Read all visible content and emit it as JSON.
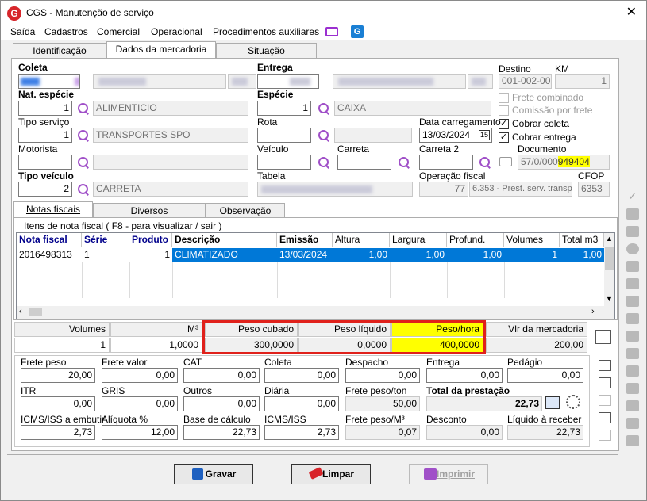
{
  "window": {
    "title": "CGS - Manutenção de serviço",
    "close": "✕"
  },
  "menu": [
    "Saída",
    "Cadastros",
    "Comercial",
    "Operacional",
    "Procedimentos auxiliares"
  ],
  "tabs": [
    "Identificação",
    "Dados da mercadoria",
    "Situação"
  ],
  "form": {
    "coleta_label": "Coleta",
    "entrega_label": "Entrega",
    "destino_label": "Destino",
    "destino_value": "001-002-002",
    "km_label": "KM",
    "km_value": "1",
    "nat_especie_label": "Nat. espécie",
    "nat_especie_code": "1",
    "nat_especie_desc": "ALIMENTICIO",
    "especie_label": "Espécie",
    "especie_code": "1",
    "especie_desc": "CAIXA",
    "tipo_servico_label": "Tipo serviço",
    "tipo_servico_code": "1",
    "tipo_servico_desc": "TRANSPORTES SPO",
    "rota_label": "Rota",
    "data_carregamento_label": "Data carregamento",
    "data_carregamento_value": "13/03/2024",
    "motorista_label": "Motorista",
    "veiculo_label": "Veículo",
    "carreta_label": "Carreta",
    "carreta2_label": "Carreta 2",
    "documento_label": "Documento",
    "documento_prefix": "57/0/000",
    "documento_highlight": "949404",
    "tipo_veiculo_label": "Tipo veículo",
    "tipo_veiculo_code": "2",
    "tipo_veiculo_desc": "CARRETA",
    "tabela_label": "Tabela",
    "operacao_fiscal_label": "Operação fiscal",
    "operacao_fiscal_code": "77",
    "operacao_fiscal_desc": "6.353 - Prest. serv. transp.",
    "cfop_label": "CFOP",
    "cfop_value": "6353",
    "frete_combinado": "Frete combinado",
    "comissao_por_frete": "Comissão por frete",
    "cobrar_coleta": "Cobrar coleta",
    "cobrar_entrega": "Cobrar entrega",
    "check_mark": "✓"
  },
  "subtabs": [
    "Notas fiscais",
    "Diversos",
    "Observação"
  ],
  "grid": {
    "caption": "Itens de nota fiscal ( F8 - para visualizar / sair )",
    "headers": [
      "Nota fiscal",
      "Série",
      "Produto",
      "Descrição",
      "Emissão",
      "Altura",
      "Largura",
      "Profund.",
      "Volumes",
      "Total m3"
    ],
    "row": [
      "2016498313",
      "1",
      "1",
      "CLIMATIZADO",
      "13/03/2024",
      "1,00",
      "1,00",
      "1,00",
      "1",
      "1,00"
    ]
  },
  "summary": {
    "volumes_label": "Volumes",
    "volumes": "1",
    "m3_label": "M³",
    "m3": "1,0000",
    "peso_cubado_label": "Peso cubado",
    "peso_cubado": "300,0000",
    "peso_liquido_label": "Peso líquido",
    "peso_liquido": "0,0000",
    "peso_hora_label": "Peso/hora",
    "peso_hora": "400,0000",
    "vlr_mercadoria_label": "Vlr da mercadoria",
    "vlr_mercadoria": "200,00"
  },
  "charges": {
    "frete_peso_label": "Frete peso",
    "frete_peso": "20,00",
    "frete_valor_label": "Frete valor",
    "frete_valor": "0,00",
    "cat_label": "CAT",
    "cat": "0,00",
    "coleta_label": "Coleta",
    "coleta": "0,00",
    "despacho_label": "Despacho",
    "despacho": "0,00",
    "entrega_label": "Entrega",
    "entrega": "0,00",
    "pedagio_label": "Pedágio",
    "pedagio": "0,00",
    "itr_label": "ITR",
    "itr": "0,00",
    "gris_label": "GRIS",
    "gris": "0,00",
    "outros_label": "Outros",
    "outros": "0,00",
    "diaria_label": "Diária",
    "diaria": "0,00",
    "frete_peso_ton_label": "Frete peso/ton",
    "frete_peso_ton": "50,00",
    "total_prestacao_label": "Total da prestação",
    "total_prestacao": "22,73",
    "icms_emb_label": "ICMS/ISS a embutir",
    "icms_emb": "2,73",
    "aliquota_label": "Alíquota %",
    "aliquota": "12,00",
    "base_calculo_label": "Base de cálculo",
    "base_calculo": "22,73",
    "icms_label": "ICMS/ISS",
    "icms": "2,73",
    "frete_peso_m3_label": "Frete peso/M³",
    "frete_peso_m3": "0,07",
    "desconto_label": "Desconto",
    "desconto": "0,00",
    "liquido_label": "Líquido à receber",
    "liquido": "22,73"
  },
  "buttons": {
    "gravar": "Gravar",
    "limpar": "Limpar",
    "imprimir": "Imprimir"
  },
  "colors": {
    "highlight": "#ffff00",
    "accent_red": "#e0211b",
    "selection": "#0078d7",
    "header_blue": "#00008b"
  }
}
